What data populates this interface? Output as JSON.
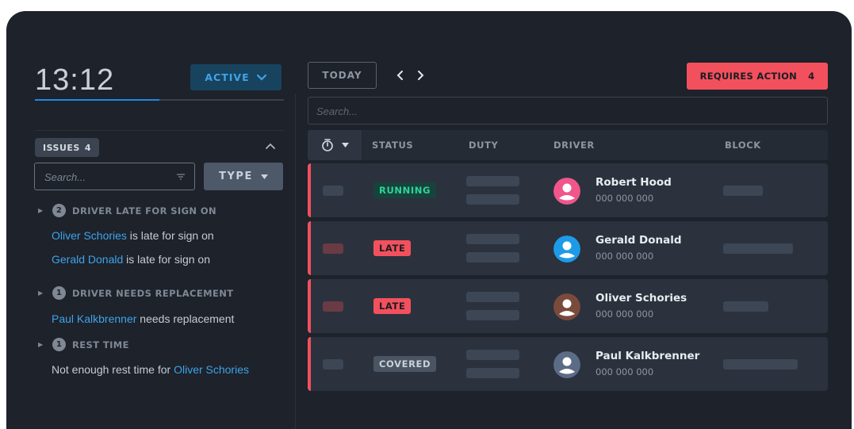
{
  "clock": {
    "time": "13:12",
    "progress": 0.5
  },
  "filter": {
    "active_label": "ACTIVE"
  },
  "issues": {
    "label": "ISSUES",
    "count": "4",
    "search_placeholder": "Search...",
    "type_label": "TYPE",
    "groups": [
      {
        "count": "2",
        "title": "DRIVER LATE FOR SIGN ON",
        "lines": [
          {
            "link": "Oliver Schories",
            "text": " is late for sign on"
          },
          {
            "link": "Gerald Donald",
            "text": " is late for sign on"
          }
        ]
      },
      {
        "count": "1",
        "title": "DRIVER NEEDS REPLACEMENT",
        "lines": [
          {
            "link": "Paul Kalkbrenner",
            "text": " needs replacement"
          }
        ]
      },
      {
        "count": "1",
        "title": "REST TIME",
        "lines": [
          {
            "prefix": "Not enough rest time for ",
            "link": "Oliver Schories"
          }
        ]
      }
    ]
  },
  "toolbar": {
    "today_label": "TODAY",
    "requires_action_label": "REQUIRES ACTION",
    "requires_action_count": "4",
    "search_placeholder": "Search..."
  },
  "table": {
    "columns": [
      "STATUS",
      "DUTY",
      "DRIVER",
      "BLOCK"
    ],
    "rows": [
      {
        "status": "RUNNING",
        "driver": "Robert Hood",
        "phone": "000 000 000",
        "avatar_color": "#f0568a"
      },
      {
        "status": "LATE",
        "driver": "Gerald Donald",
        "phone": "000 000 000",
        "avatar_color": "#1e9be8"
      },
      {
        "status": "LATE",
        "driver": "Oliver Schories",
        "phone": "000 000 000",
        "avatar_color": "#7a4a3c"
      },
      {
        "status": "COVERED",
        "driver": "Paul Kalkbrenner",
        "phone": "000 000 000",
        "avatar_color": "#5c6c86"
      }
    ]
  },
  "colors": {
    "accent_blue": "#3fa3e8",
    "alert_red": "#f3505d",
    "running_green": "#2ed39a",
    "background": "#1d222b"
  }
}
